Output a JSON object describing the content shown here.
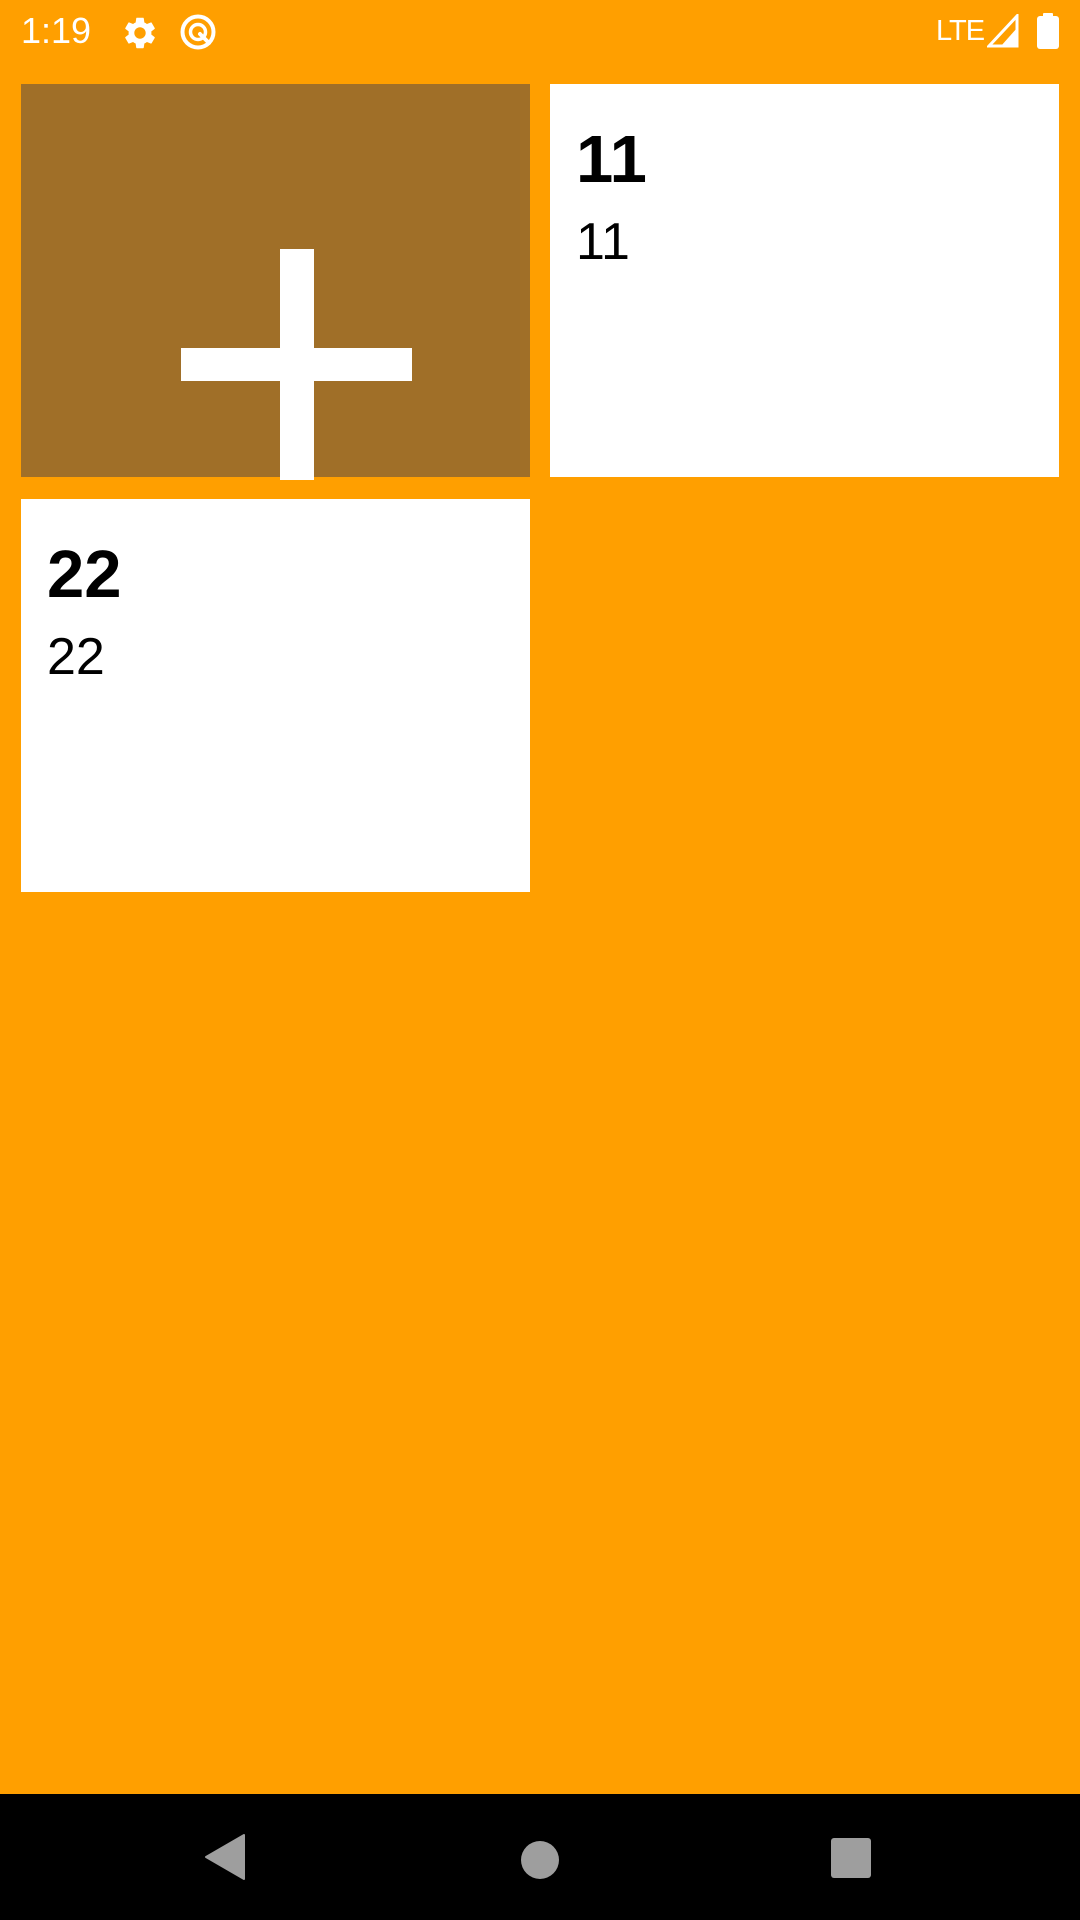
{
  "status_bar": {
    "time": "1:19",
    "network": "LTE",
    "icons": [
      "settings-gear-icon",
      "sync-icon",
      "signal-icon",
      "battery-icon"
    ]
  },
  "add_tile": {
    "icon": "plus-icon",
    "background_color": "#A06F28"
  },
  "notes": [
    {
      "title": "11",
      "body": "11"
    },
    {
      "title": "22",
      "body": "22"
    }
  ],
  "nav_bar": {
    "buttons": [
      "back-icon",
      "home-icon",
      "recents-icon"
    ]
  },
  "colors": {
    "background": "#FF9F00",
    "tile": "#FFFFFF",
    "nav_bar": "#000000",
    "nav_button": "#9E9E9E"
  }
}
